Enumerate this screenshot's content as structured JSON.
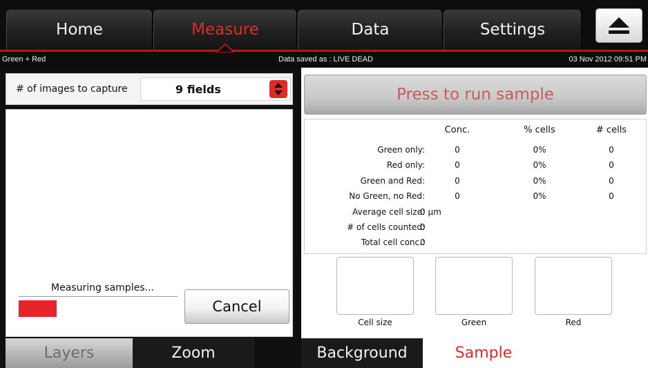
{
  "nav": {
    "tabs": [
      {
        "label": "Home"
      },
      {
        "label": "Measure"
      },
      {
        "label": "Data"
      },
      {
        "label": "Settings"
      }
    ],
    "active_tab": "Measure",
    "eject_icon": "eject-icon",
    "accent_color": "#e02a2a"
  },
  "status": {
    "left": "Green + Red",
    "center": "Data saved as : LIVE DEAD",
    "right": "03 Nov 2012  09:51 PM"
  },
  "capture": {
    "label": "# of images to capture",
    "value": "9 fields",
    "arrows_icon": "up-down-arrows-icon"
  },
  "progress": {
    "label": "Measuring samples...",
    "fraction": 0.24,
    "color": "#e5252b",
    "cancel_label": "Cancel"
  },
  "run_button": {
    "label": "Press to run sample"
  },
  "results": {
    "headers": {
      "conc": "Conc.",
      "pct": "% cells",
      "count": "# cells"
    },
    "rows": [
      {
        "label": "Green only:",
        "conc": "0",
        "pct": "0%",
        "count": "0"
      },
      {
        "label": "Red only:",
        "conc": "0",
        "pct": "0%",
        "count": "0"
      },
      {
        "label": "Green and Red:",
        "conc": "0",
        "pct": "0%",
        "count": "0"
      },
      {
        "label": "No Green, no Red:",
        "conc": "0",
        "pct": "0%",
        "count": "0"
      }
    ],
    "singles": [
      {
        "label": "Average cell size:",
        "value": "0 µm"
      },
      {
        "label": "# of cells counted:",
        "value": "0"
      },
      {
        "label": "Total cell conc.:",
        "value": "0"
      }
    ]
  },
  "thumbnails": {
    "cell_size": "Cell size",
    "green": "Green",
    "red": "Red"
  },
  "bottom_tabs": {
    "layers": "Layers",
    "zoom": "Zoom",
    "background": "Background",
    "sample": "Sample"
  }
}
